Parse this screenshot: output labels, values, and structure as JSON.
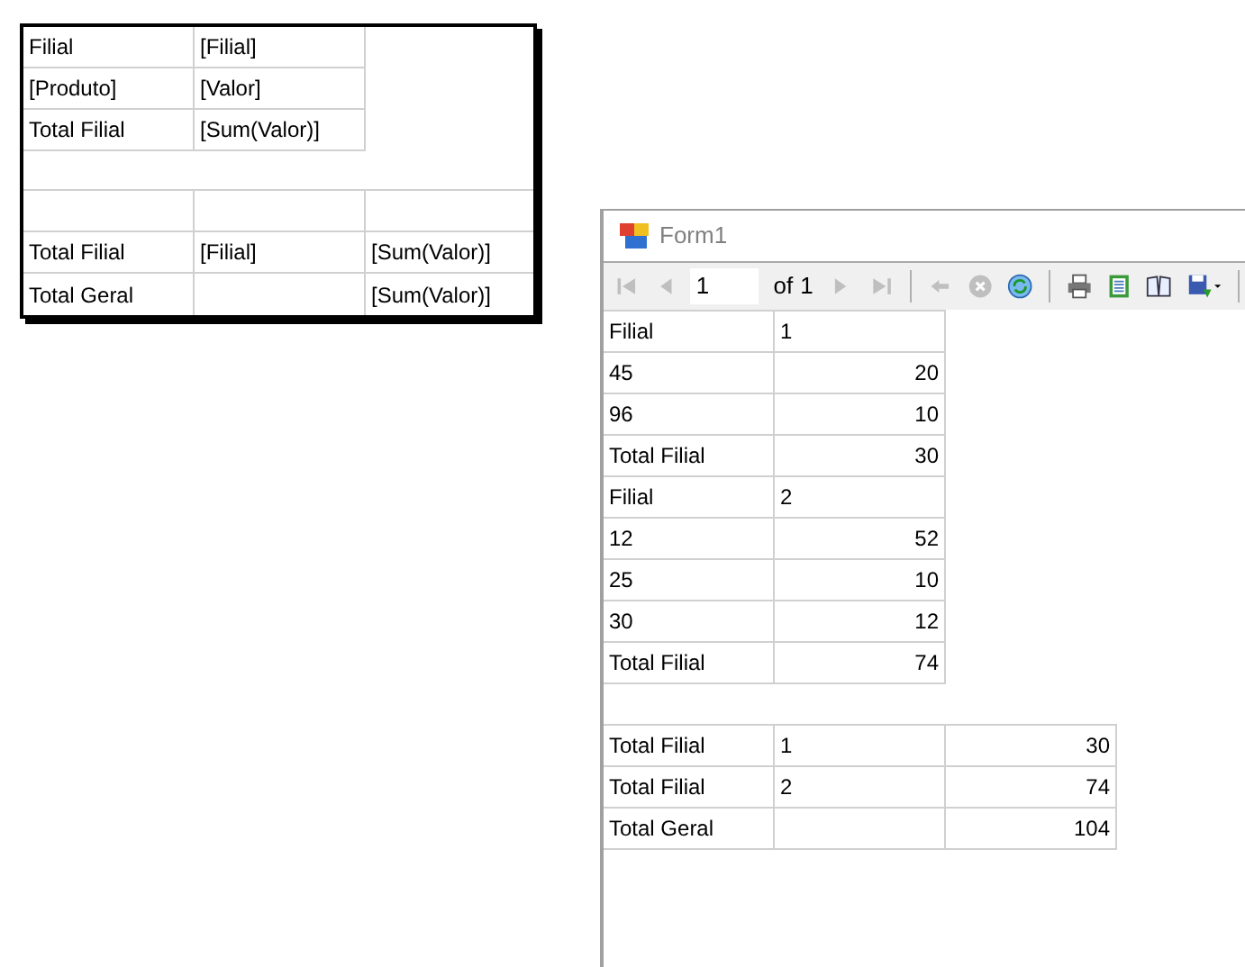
{
  "designer": {
    "group_rows": [
      [
        "Filial",
        "[Filial]"
      ],
      [
        "[Produto]",
        "[Valor]"
      ],
      [
        "Total Filial",
        "[Sum(Valor)]"
      ]
    ],
    "summary_rows": [
      [
        "",
        "",
        ""
      ],
      [
        "Total Filial",
        "[Filial]",
        "[Sum(Valor)]"
      ],
      [
        "Total Geral",
        "",
        "[Sum(Valor)]"
      ]
    ]
  },
  "window": {
    "title": "Form1",
    "toolbar": {
      "buttons": [
        {
          "kind": "first",
          "disabled": true
        },
        {
          "kind": "prev",
          "disabled": true
        },
        {
          "kind": "page"
        },
        {
          "kind": "next",
          "disabled": true
        },
        {
          "kind": "last",
          "disabled": true
        },
        {
          "kind": "sep"
        },
        {
          "kind": "back",
          "disabled": true
        },
        {
          "kind": "stop",
          "disabled": true
        },
        {
          "kind": "refresh",
          "disabled": false
        },
        {
          "kind": "sep"
        },
        {
          "kind": "print",
          "disabled": false
        },
        {
          "kind": "layout",
          "disabled": false
        },
        {
          "kind": "setup",
          "disabled": false
        },
        {
          "kind": "export",
          "disabled": false
        },
        {
          "kind": "sep"
        }
      ],
      "page": "1",
      "of_label": "of",
      "total": "1"
    },
    "report": {
      "group_rows": [
        {
          "kind": "header",
          "cells": [
            "Filial",
            "1"
          ]
        },
        {
          "kind": "detail",
          "cells": [
            "45",
            "20"
          ]
        },
        {
          "kind": "detail",
          "cells": [
            "96",
            "10"
          ]
        },
        {
          "kind": "total",
          "cells": [
            "Total Filial",
            "30"
          ]
        },
        {
          "kind": "header",
          "cells": [
            "Filial",
            "2"
          ]
        },
        {
          "kind": "detail",
          "cells": [
            "12",
            "52"
          ]
        },
        {
          "kind": "detail",
          "cells": [
            "25",
            "10"
          ]
        },
        {
          "kind": "detail",
          "cells": [
            "30",
            "12"
          ]
        },
        {
          "kind": "total",
          "cells": [
            "Total Filial",
            "74"
          ]
        }
      ],
      "summary_rows": [
        [
          "Total Filial",
          "1",
          "30"
        ],
        [
          "Total Filial",
          "2",
          "74"
        ],
        [
          "Total Geral",
          "",
          "104"
        ]
      ]
    }
  }
}
